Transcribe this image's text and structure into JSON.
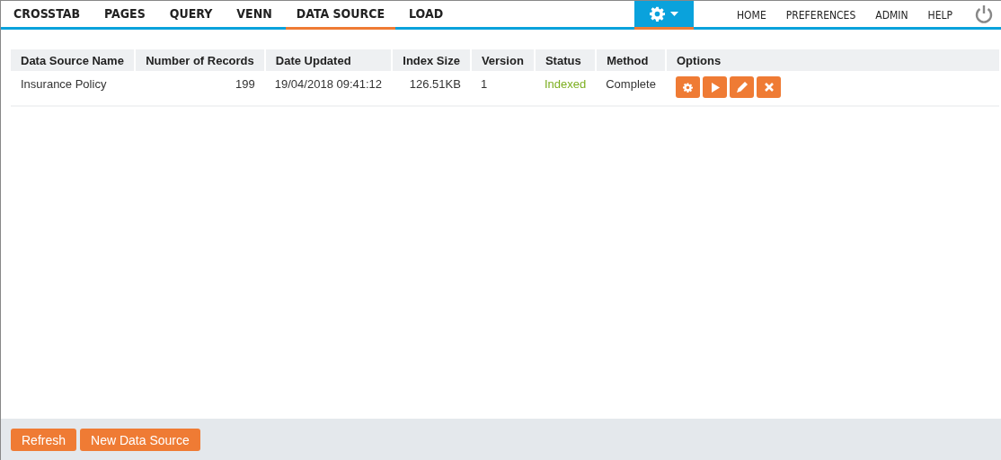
{
  "nav": {
    "tabs": [
      {
        "label": "CROSSTAB",
        "selected": false
      },
      {
        "label": "PAGES",
        "selected": false
      },
      {
        "label": "QUERY",
        "selected": false
      },
      {
        "label": "VENN",
        "selected": false
      },
      {
        "label": "DATA SOURCE",
        "selected": true
      },
      {
        "label": "LOAD",
        "selected": false
      }
    ],
    "links": [
      "HOME",
      "PREFERENCES",
      "ADMIN",
      "HELP"
    ]
  },
  "table": {
    "columns": [
      {
        "label": "Data Source Name",
        "kind": "text"
      },
      {
        "label": "Number of Records",
        "kind": "number"
      },
      {
        "label": "Date Updated",
        "kind": "text"
      },
      {
        "label": "Index Size",
        "kind": "number"
      },
      {
        "label": "Version",
        "kind": "text"
      },
      {
        "label": "Status",
        "kind": "status"
      },
      {
        "label": "Method",
        "kind": "text"
      },
      {
        "label": "Options",
        "kind": "actions"
      }
    ],
    "rows": [
      {
        "cells": [
          "Insurance Policy",
          "199",
          "19/04/2018 09:41:12",
          "126.51KB",
          "1",
          "Indexed",
          "Complete"
        ],
        "options": [
          {
            "kind": "settings"
          },
          {
            "kind": "run"
          },
          {
            "kind": "edit"
          },
          {
            "kind": "delete"
          }
        ]
      }
    ]
  },
  "footer": {
    "buttons": [
      "Refresh",
      "New Data Source"
    ]
  }
}
